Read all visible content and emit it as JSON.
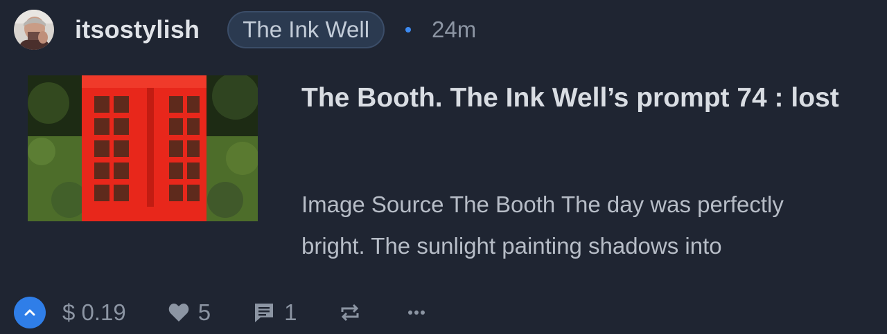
{
  "post": {
    "author": "itsostylish",
    "community": "The Ink Well",
    "time_ago": "24m",
    "title": "The Booth. The Ink Well’s prompt 74 : lost",
    "excerpt_line1": "Image Source The Booth The day was perfectly",
    "excerpt_line2": "bright. The sunlight painting shadows into"
  },
  "footer": {
    "payout": "$ 0.19",
    "likes": "5",
    "comments": "1"
  },
  "icons": {
    "avatar": "avatar-photo",
    "upvote": "chevron-up-icon",
    "like": "heart-icon",
    "comment": "comment-icon",
    "reblog": "repeat-icon",
    "more": "ellipsis-icon"
  },
  "colors": {
    "background": "#1f2532",
    "accent": "#2f7ee8",
    "community_pill": "#2b3a50",
    "booth_red": "#e8271b"
  }
}
